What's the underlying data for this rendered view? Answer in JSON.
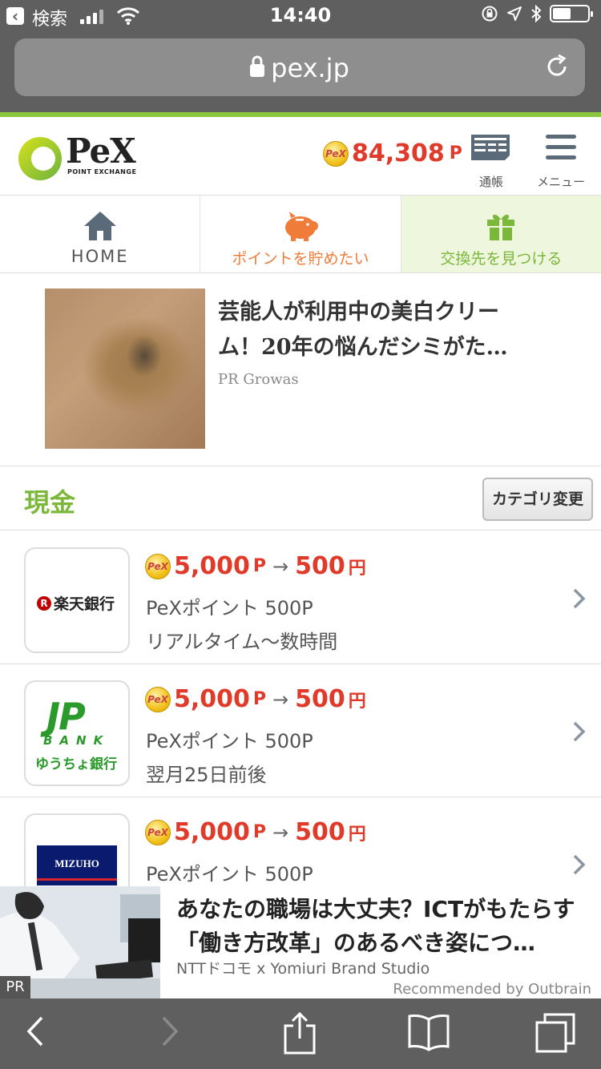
{
  "status_bar": {
    "back_app": "検索",
    "time": "14:40"
  },
  "browser": {
    "url": "pex.jp"
  },
  "header": {
    "logo_text": "PeX",
    "logo_sub": "POINT EXCHANGE",
    "coin_label": "PeX",
    "points": "84,308",
    "points_unit": "P",
    "passbook_label": "通帳",
    "menu_label": "メニュー"
  },
  "nav": {
    "tabs": [
      {
        "label": "HOME",
        "icon": "home-icon"
      },
      {
        "label": "ポイントを貯めたい",
        "icon": "piggy-bank-icon"
      },
      {
        "label": "交換先を見つける",
        "icon": "gift-icon"
      }
    ]
  },
  "pr_article": {
    "title": "芸能人が利用中の美白クリーム！20年の悩んだシミがた…",
    "source": "PR Growas"
  },
  "section": {
    "title": "現金",
    "category_button": "カテゴリ変更"
  },
  "exchange_items": [
    {
      "logo": "楽天銀行",
      "from_points": "5,000",
      "from_unit": "P",
      "arrow": "→",
      "to_value": "500",
      "to_unit": "円",
      "name": "PeXポイント 500P",
      "time": "リアルタイム〜数時間"
    },
    {
      "logo_mark": "JP",
      "logo_bank": "BANK",
      "logo_name": "ゆうちょ銀行",
      "from_points": "5,000",
      "from_unit": "P",
      "arrow": "→",
      "to_value": "500",
      "to_unit": "円",
      "name": "PeXポイント 500P",
      "time": "翌月25日前後"
    },
    {
      "logo": "MIZUHO",
      "from_points": "5,000",
      "from_unit": "P",
      "arrow": "→",
      "to_value": "500",
      "to_unit": "円",
      "name": "PeXポイント 500P",
      "time": ""
    }
  ],
  "ad": {
    "badge": "PR",
    "title": "あなたの職場は大丈夫？ICTがもたらす「働き方改革」のあるべき姿につ…",
    "source": "NTTドコモ x Yomiuri Brand Studio",
    "recommended": "Recommended by Outbrain"
  },
  "colors": {
    "brand_green": "#8cc63f",
    "points_red": "#e03a2a",
    "save_orange": "#f07c3a",
    "browser_chrome": "#5f5f5f"
  }
}
